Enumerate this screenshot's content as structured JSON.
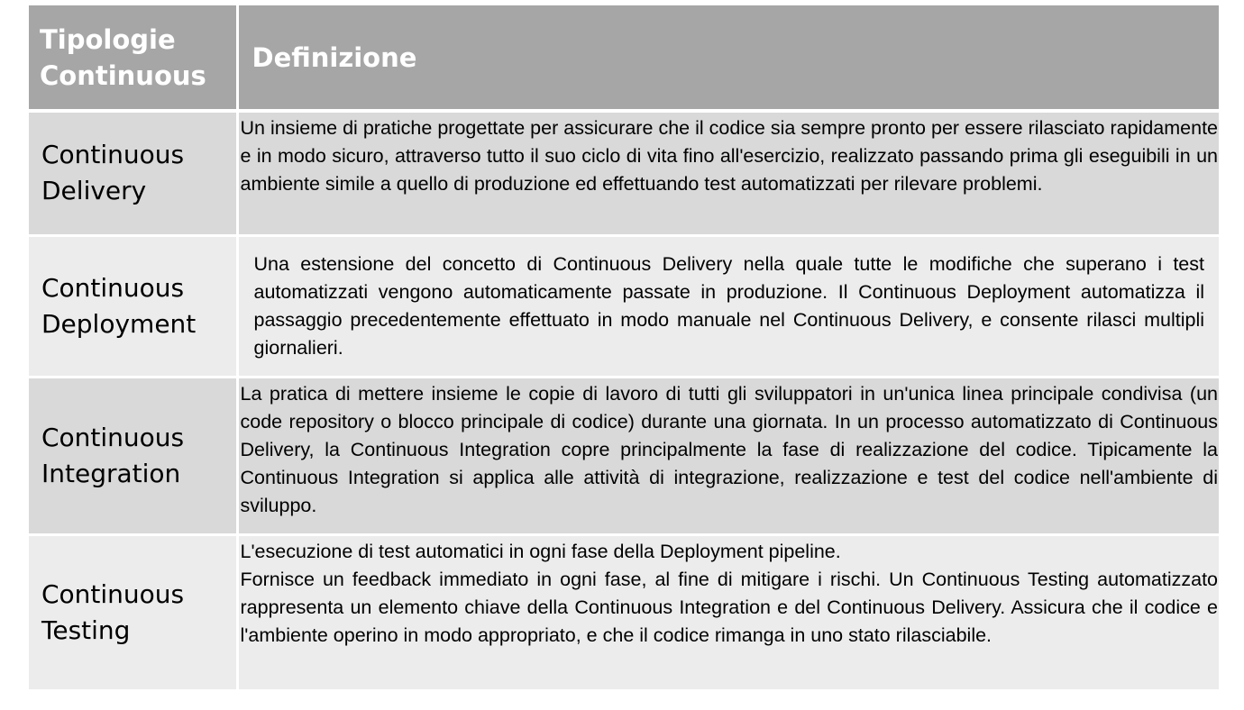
{
  "table": {
    "headers": {
      "type": "Tipologie\nContinuous",
      "definition": "Definizione"
    },
    "rows": [
      {
        "type": "Continuous\nDelivery",
        "definition": [
          "Un insieme di pratiche progettate per assicurare che il codice sia sempre pronto per essere rilasciato rapidamente e in modo sicuro, attraverso tutto il suo ciclo di vita fino all'esercizio, realizzato passando prima gli eseguibili in un ambiente simile a quello di produzione ed effettuando test automatizzati per rilevare problemi."
        ]
      },
      {
        "type": "Continuous\nDeployment",
        "definition": [
          "Una estensione del concetto di Continuous Delivery nella quale tutte le modifiche che superano i test automatizzati vengono automaticamente passate in produzione. Il Continuous Deployment automatizza il passaggio precedentemente effettuato in modo manuale nel Continuous Delivery, e consente rilasci multipli giornalieri."
        ]
      },
      {
        "type": "Continuous\nIntegration",
        "definition": [
          "La pratica di mettere insieme le copie di lavoro di tutti gli sviluppatori in un'unica linea principale condivisa (un code repository o blocco principale di codice) durante una giornata. In un processo automatizzato di Continuous Delivery, la Continuous Integration copre principalmente la fase di realizzazione del codice. Tipicamente la Continuous Integration si applica alle attività di integrazione, realizzazione e test del codice nell'ambiente di sviluppo."
        ]
      },
      {
        "type": "Continuous\nTesting",
        "definition": [
          "L'esecuzione di test automatici in ogni fase della Deployment pipeline.",
          "Fornisce un feedback immediato in ogni fase, al fine di mitigare i rischi. Un Continuous Testing automatizzato rappresenta un elemento chiave della Continuous Integration e del Continuous Delivery. Assicura che il codice e l'ambiente operino in modo appropriato, e che il codice rimanga in uno stato rilasciabile."
        ]
      }
    ]
  }
}
